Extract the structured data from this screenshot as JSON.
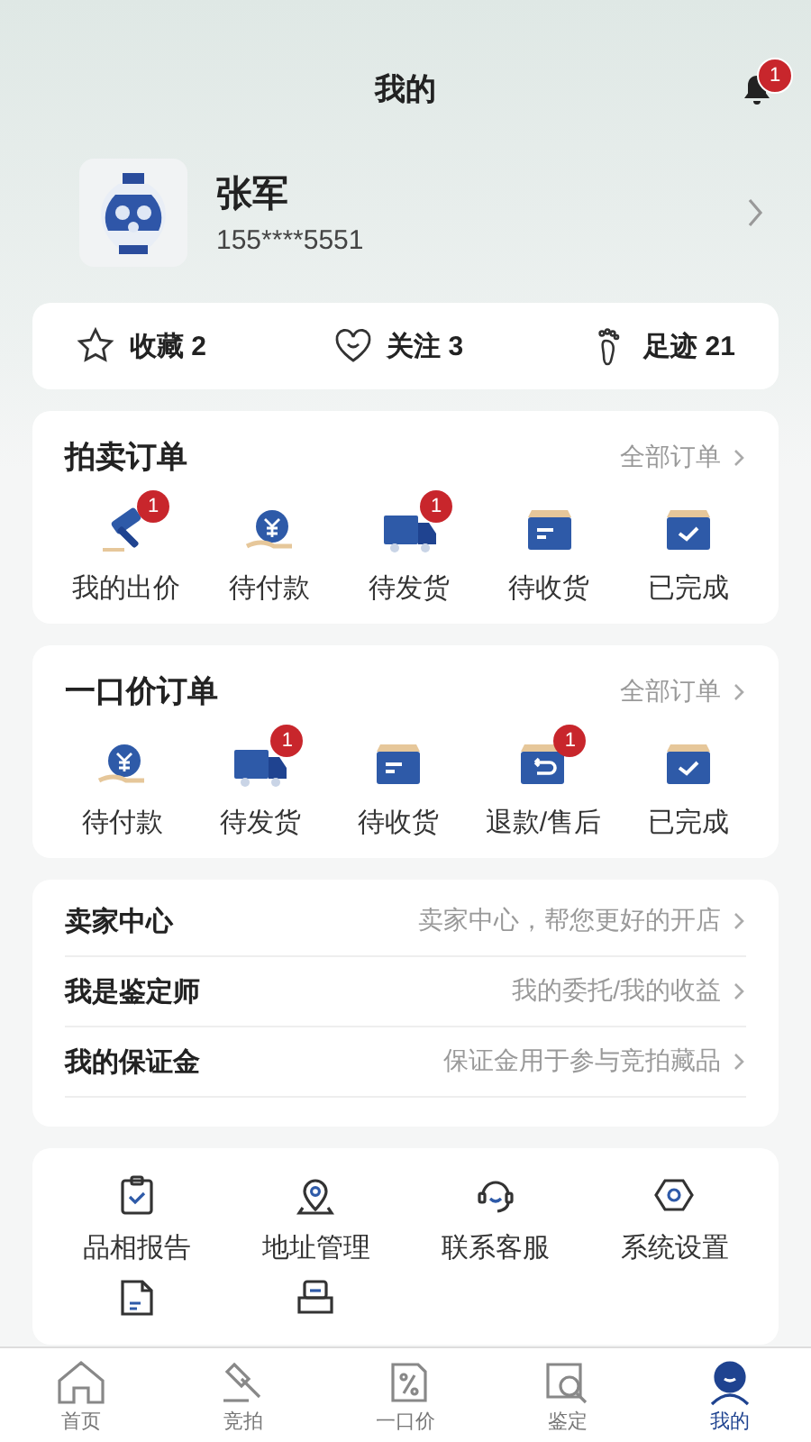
{
  "header": {
    "title": "我的",
    "notification_badge": "1"
  },
  "profile": {
    "name": "张军",
    "phone": "155****5551"
  },
  "stats": [
    {
      "kind": "star",
      "label": "收藏",
      "count": "2"
    },
    {
      "kind": "heart",
      "label": "关注",
      "count": "3"
    },
    {
      "kind": "foot",
      "label": "足迹",
      "count": "21"
    }
  ],
  "auction_orders": {
    "title": "拍卖订单",
    "link": "全部订单",
    "items": [
      {
        "kind": "gavel",
        "label": "我的出价",
        "badge": "1"
      },
      {
        "kind": "pay",
        "label": "待付款"
      },
      {
        "kind": "truck",
        "label": "待发货",
        "badge": "1"
      },
      {
        "kind": "box",
        "label": "待收货"
      },
      {
        "kind": "done",
        "label": "已完成"
      }
    ]
  },
  "fixed_price_orders": {
    "title": "一口价订单",
    "link": "全部订单",
    "items": [
      {
        "kind": "pay",
        "label": "待付款"
      },
      {
        "kind": "truck",
        "label": "待发货",
        "badge": "1"
      },
      {
        "kind": "box",
        "label": "待收货"
      },
      {
        "kind": "refund",
        "label": "退款/售后",
        "badge": "1"
      },
      {
        "kind": "done",
        "label": "已完成"
      }
    ]
  },
  "services": [
    {
      "label": "卖家中心",
      "hint": "卖家中心，帮您更好的开店"
    },
    {
      "label": "我是鉴定师",
      "hint": "我的委托/我的收益"
    },
    {
      "label": "我的保证金",
      "hint": "保证金用于参与竞拍藏品"
    }
  ],
  "tools": [
    {
      "kind": "report",
      "label": "品相报告"
    },
    {
      "kind": "address",
      "label": "地址管理"
    },
    {
      "kind": "service",
      "label": "联系客服"
    },
    {
      "kind": "settings",
      "label": "系统设置"
    },
    {
      "kind": "guide"
    },
    {
      "kind": "invite"
    }
  ],
  "tab_bar": [
    {
      "kind": "home",
      "label": "首页",
      "selected": false
    },
    {
      "kind": "auction",
      "label": "竞拍",
      "selected": false
    },
    {
      "kind": "price",
      "label": "一口价",
      "selected": false
    },
    {
      "kind": "appraise",
      "label": "鉴定",
      "selected": false
    },
    {
      "kind": "me",
      "label": "我的",
      "selected": true
    }
  ]
}
